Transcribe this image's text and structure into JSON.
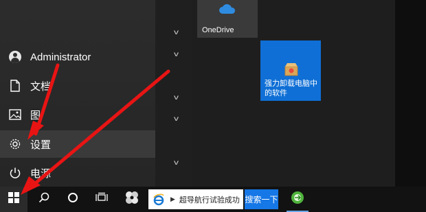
{
  "start_menu": {
    "user_name": "Administrator",
    "items": [
      {
        "label": "文档",
        "icon": "document-icon"
      },
      {
        "label": "图",
        "icon": "picture-icon"
      },
      {
        "label": "设置",
        "icon": "gear-icon"
      },
      {
        "label": "电源",
        "icon": "power-icon"
      }
    ]
  },
  "tiles": {
    "onedrive": {
      "label": "OneDrive",
      "icon": "onedrive-cloud-icon"
    },
    "uninstall": {
      "label": "强力卸载电脑中的软件",
      "icon": "uninstall-package-icon"
    }
  },
  "taskbar": {
    "search_text": "超导航行试验成功",
    "search_button": "搜索一下",
    "icons": [
      "windows-start-icon",
      "search-icon",
      "cortana-icon",
      "task-view-icon",
      "app-icon",
      "ie-icon",
      "browser-icon"
    ]
  },
  "colors": {
    "accent_tile": "#0f6fd6",
    "arrow": "#e81414",
    "search_button": "#1677e6"
  }
}
